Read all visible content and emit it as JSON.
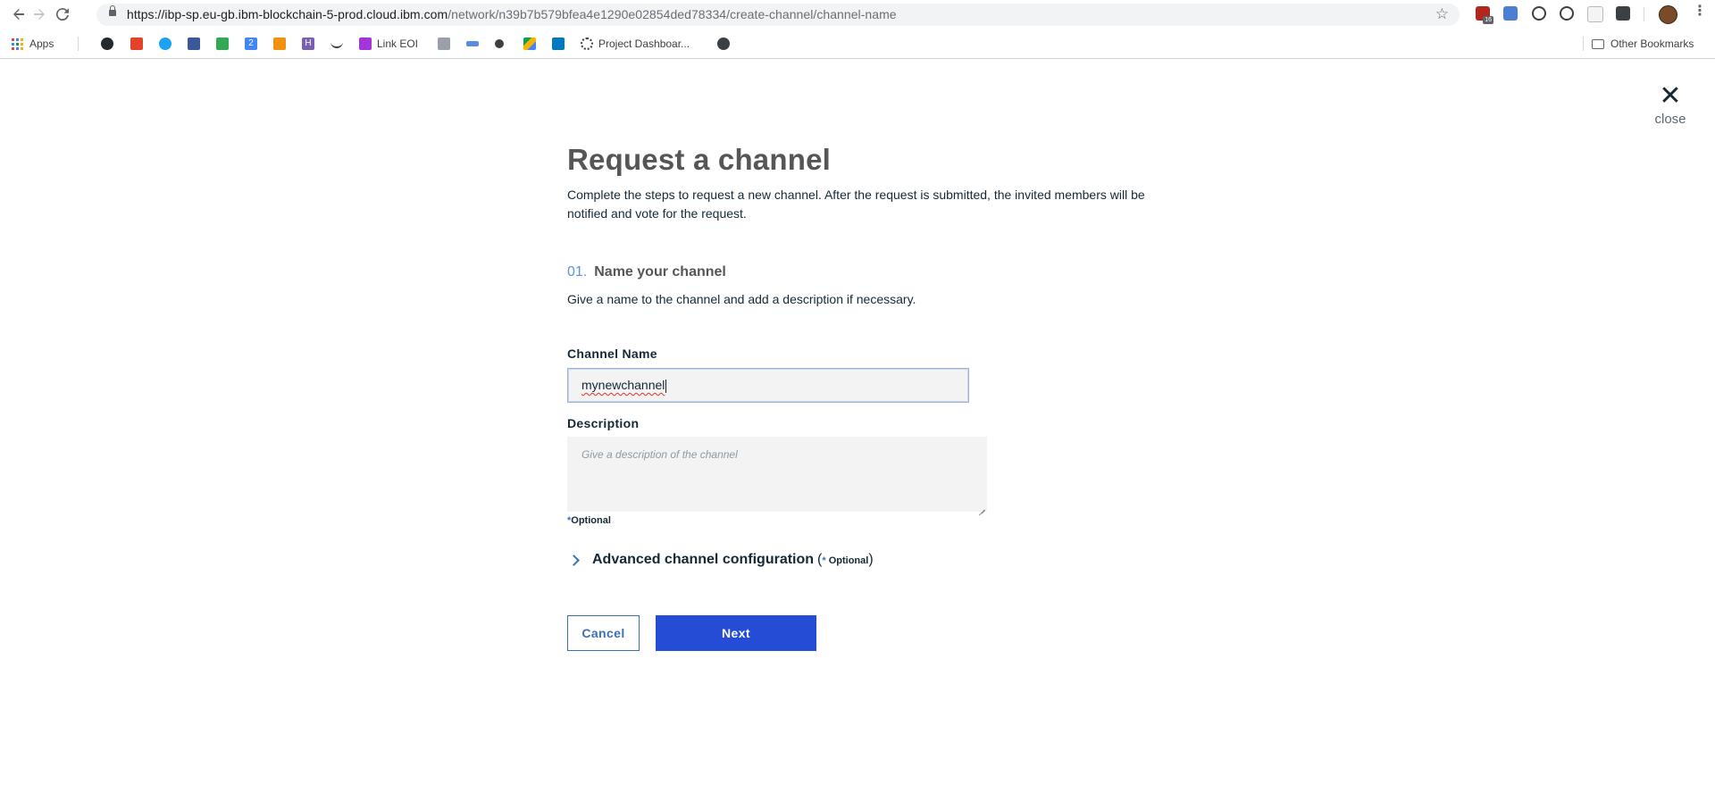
{
  "browser": {
    "url_host": "https://ibp-sp.eu-gb.ibm-blockchain-5-prod.cloud.ibm.com",
    "url_path": "/network/n39b7b579bfea4e1290e02854ded78334/create-channel/channel-name",
    "extension_badge": "16",
    "bookmarks": {
      "apps_label": "Apps",
      "link_eoi_label": "Link EOI",
      "project_dashboard_label": "Project Dashboar...",
      "other_bookmarks_label": "Other Bookmarks",
      "numbered_icon_label": "2",
      "h_icon_label": "H"
    }
  },
  "page": {
    "close_label": "close",
    "title": "Request a channel",
    "intro": "Complete the steps to request a new channel. After the request is submitted, the invited members will be notified and vote for the request.",
    "step": {
      "number": "01.",
      "title": "Name your channel",
      "description": "Give a name to the channel and add a description if necessary."
    },
    "channel_name": {
      "label": "Channel Name",
      "value": "mynewchannel"
    },
    "description": {
      "label": "Description",
      "placeholder": "Give a description of the channel"
    },
    "optional_note": {
      "asterisk": "*",
      "text": "Optional"
    },
    "advanced": {
      "label": "Advanced channel configuration",
      "open_paren": "(",
      "asterisk": "*",
      "optional": " Optional",
      "close_paren": ")"
    },
    "buttons": {
      "cancel": "Cancel",
      "next": "Next"
    }
  },
  "colors": {
    "primary_button": "#254cd4",
    "link_blue": "#3d70b2",
    "step_number": "#5596e6",
    "title_gray": "#565656"
  },
  "icons": {
    "back": "arrow-left-icon",
    "forward": "arrow-right-icon",
    "reload": "reload-icon",
    "lock": "lock-icon",
    "bookmark_star": "star-icon",
    "close": "close-icon",
    "expand": "chevron-right-icon",
    "menu": "kebab-menu-icon"
  }
}
